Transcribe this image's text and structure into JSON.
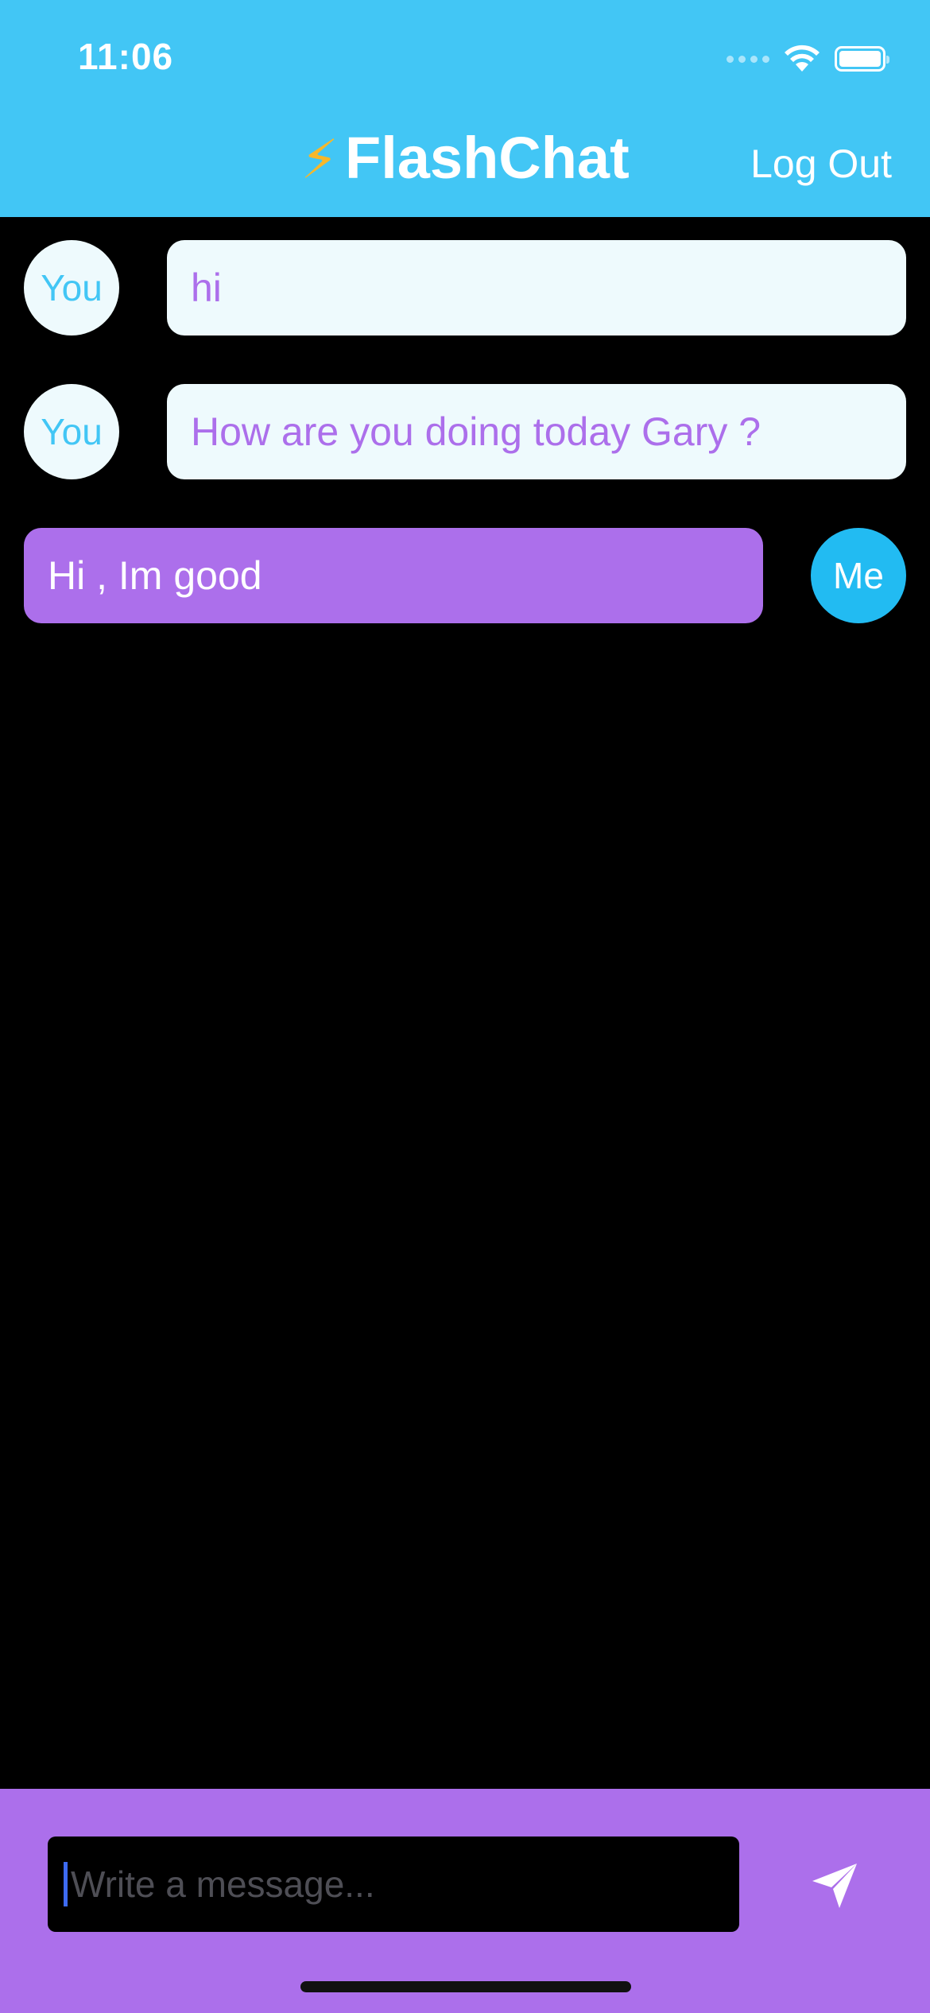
{
  "status_bar": {
    "time": "11:06",
    "icons": [
      "cellular-icon",
      "wifi-icon",
      "battery-icon"
    ]
  },
  "nav": {
    "title": "FlashChat",
    "title_icon": "lightning-bolt-icon",
    "logout_label": "Log Out"
  },
  "messages": [
    {
      "sender": "You",
      "text": "hi",
      "outgoing": false
    },
    {
      "sender": "You",
      "text": "How are you doing today Gary ?",
      "outgoing": false
    },
    {
      "sender": "Me",
      "text": "Hi , Im good",
      "outgoing": true
    }
  ],
  "composer": {
    "placeholder": "Write a message...",
    "value": "",
    "send_icon": "send-icon"
  },
  "colors": {
    "header": "#42C6F5",
    "accent_purple": "#AC6FEB",
    "incoming_bubble": "#EEFAFD",
    "me_avatar": "#22BBF2",
    "background": "#000000"
  }
}
